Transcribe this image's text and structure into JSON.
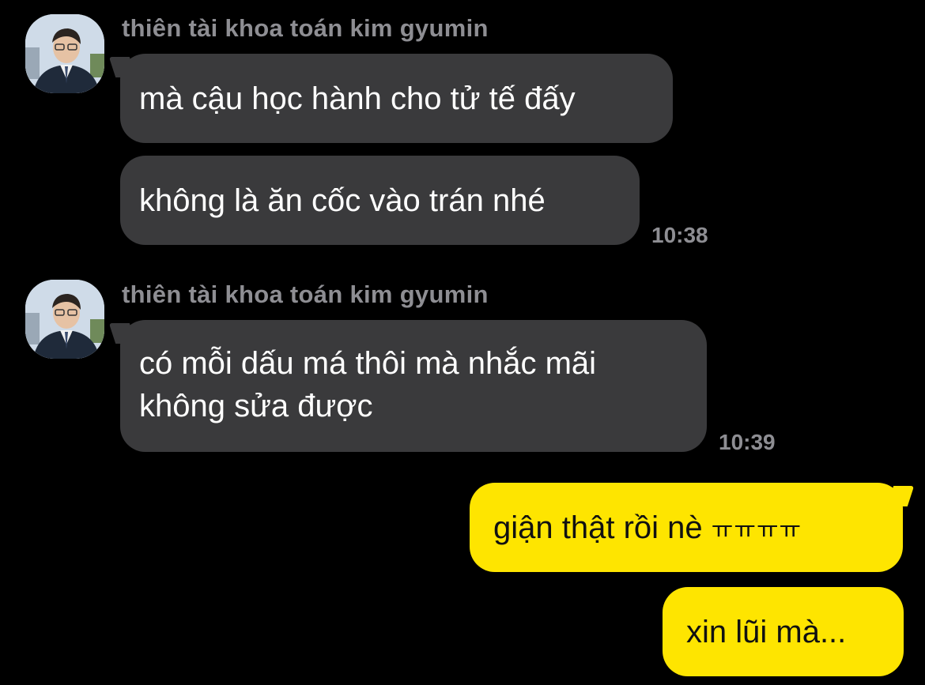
{
  "chat": {
    "groups": [
      {
        "sender": "thiên tài khoa toán kim gyumin",
        "avatar_icon": "profile-photo-avatar",
        "messages": [
          {
            "lines": [
              "mà cậu học hành cho tử tế đấy"
            ]
          },
          {
            "lines": [
              "không là ăn cốc vào trán nhé"
            ]
          }
        ],
        "time": "10:38"
      },
      {
        "sender": "thiên tài khoa toán kim gyumin",
        "avatar_icon": "profile-photo-avatar",
        "messages": [
          {
            "lines": [
              "có mỗi dấu má thôi mà nhắc mãi",
              "không sửa được"
            ]
          }
        ],
        "time": "10:39"
      }
    ],
    "outgoing": [
      {
        "text": "giận thật rồi nè ",
        "suffix": "ㅠㅠㅠㅠ"
      },
      {
        "text": "xin lũi mà..."
      }
    ]
  },
  "colors": {
    "background": "#000000",
    "incoming_bubble": "#3a3a3c",
    "outgoing_bubble": "#fee500",
    "meta_text": "#8e8e93"
  }
}
